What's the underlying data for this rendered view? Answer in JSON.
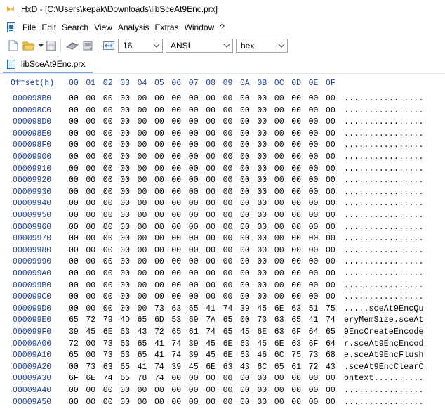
{
  "window": {
    "title": "HxD - [C:\\Users\\kepak\\Downloads\\libSceAt9Enc.prx]"
  },
  "menu": {
    "items": [
      "File",
      "Edit",
      "Search",
      "View",
      "Analysis",
      "Extras",
      "Window",
      "?"
    ]
  },
  "toolbar": {
    "bytes_per_row": "16",
    "charset": "ANSI",
    "display_mode": "hex"
  },
  "tab": {
    "label": "libSceAt9Enc.prx"
  },
  "hex": {
    "offset_header": "Offset(h)",
    "column_headers": [
      "00",
      "01",
      "02",
      "03",
      "04",
      "05",
      "06",
      "07",
      "08",
      "09",
      "0A",
      "0B",
      "0C",
      "0D",
      "0E",
      "0F"
    ],
    "rows": [
      {
        "offset": "000098B0",
        "bytes": [
          "00",
          "00",
          "00",
          "00",
          "00",
          "00",
          "00",
          "00",
          "00",
          "00",
          "00",
          "00",
          "00",
          "00",
          "00",
          "00"
        ],
        "ascii": "................"
      },
      {
        "offset": "000098C0",
        "bytes": [
          "00",
          "00",
          "00",
          "00",
          "00",
          "00",
          "00",
          "00",
          "00",
          "00",
          "00",
          "00",
          "00",
          "00",
          "00",
          "00"
        ],
        "ascii": "................"
      },
      {
        "offset": "000098D0",
        "bytes": [
          "00",
          "00",
          "00",
          "00",
          "00",
          "00",
          "00",
          "00",
          "00",
          "00",
          "00",
          "00",
          "00",
          "00",
          "00",
          "00"
        ],
        "ascii": "................"
      },
      {
        "offset": "000098E0",
        "bytes": [
          "00",
          "00",
          "00",
          "00",
          "00",
          "00",
          "00",
          "00",
          "00",
          "00",
          "00",
          "00",
          "00",
          "00",
          "00",
          "00"
        ],
        "ascii": "................"
      },
      {
        "offset": "000098F0",
        "bytes": [
          "00",
          "00",
          "00",
          "00",
          "00",
          "00",
          "00",
          "00",
          "00",
          "00",
          "00",
          "00",
          "00",
          "00",
          "00",
          "00"
        ],
        "ascii": "................"
      },
      {
        "offset": "00009900",
        "bytes": [
          "00",
          "00",
          "00",
          "00",
          "00",
          "00",
          "00",
          "00",
          "00",
          "00",
          "00",
          "00",
          "00",
          "00",
          "00",
          "00"
        ],
        "ascii": "................"
      },
      {
        "offset": "00009910",
        "bytes": [
          "00",
          "00",
          "00",
          "00",
          "00",
          "00",
          "00",
          "00",
          "00",
          "00",
          "00",
          "00",
          "00",
          "00",
          "00",
          "00"
        ],
        "ascii": "................"
      },
      {
        "offset": "00009920",
        "bytes": [
          "00",
          "00",
          "00",
          "00",
          "00",
          "00",
          "00",
          "00",
          "00",
          "00",
          "00",
          "00",
          "00",
          "00",
          "00",
          "00"
        ],
        "ascii": "................"
      },
      {
        "offset": "00009930",
        "bytes": [
          "00",
          "00",
          "00",
          "00",
          "00",
          "00",
          "00",
          "00",
          "00",
          "00",
          "00",
          "00",
          "00",
          "00",
          "00",
          "00"
        ],
        "ascii": "................"
      },
      {
        "offset": "00009940",
        "bytes": [
          "00",
          "00",
          "00",
          "00",
          "00",
          "00",
          "00",
          "00",
          "00",
          "00",
          "00",
          "00",
          "00",
          "00",
          "00",
          "00"
        ],
        "ascii": "................"
      },
      {
        "offset": "00009950",
        "bytes": [
          "00",
          "00",
          "00",
          "00",
          "00",
          "00",
          "00",
          "00",
          "00",
          "00",
          "00",
          "00",
          "00",
          "00",
          "00",
          "00"
        ],
        "ascii": "................"
      },
      {
        "offset": "00009960",
        "bytes": [
          "00",
          "00",
          "00",
          "00",
          "00",
          "00",
          "00",
          "00",
          "00",
          "00",
          "00",
          "00",
          "00",
          "00",
          "00",
          "00"
        ],
        "ascii": "................"
      },
      {
        "offset": "00009970",
        "bytes": [
          "00",
          "00",
          "00",
          "00",
          "00",
          "00",
          "00",
          "00",
          "00",
          "00",
          "00",
          "00",
          "00",
          "00",
          "00",
          "00"
        ],
        "ascii": "................"
      },
      {
        "offset": "00009980",
        "bytes": [
          "00",
          "00",
          "00",
          "00",
          "00",
          "00",
          "00",
          "00",
          "00",
          "00",
          "00",
          "00",
          "00",
          "00",
          "00",
          "00"
        ],
        "ascii": "................"
      },
      {
        "offset": "00009990",
        "bytes": [
          "00",
          "00",
          "00",
          "00",
          "00",
          "00",
          "00",
          "00",
          "00",
          "00",
          "00",
          "00",
          "00",
          "00",
          "00",
          "00"
        ],
        "ascii": "................"
      },
      {
        "offset": "000099A0",
        "bytes": [
          "00",
          "00",
          "00",
          "00",
          "00",
          "00",
          "00",
          "00",
          "00",
          "00",
          "00",
          "00",
          "00",
          "00",
          "00",
          "00"
        ],
        "ascii": "................"
      },
      {
        "offset": "000099B0",
        "bytes": [
          "00",
          "00",
          "00",
          "00",
          "00",
          "00",
          "00",
          "00",
          "00",
          "00",
          "00",
          "00",
          "00",
          "00",
          "00",
          "00"
        ],
        "ascii": "................"
      },
      {
        "offset": "000099C0",
        "bytes": [
          "00",
          "00",
          "00",
          "00",
          "00",
          "00",
          "00",
          "00",
          "00",
          "00",
          "00",
          "00",
          "00",
          "00",
          "00",
          "00"
        ],
        "ascii": "................"
      },
      {
        "offset": "000099D0",
        "bytes": [
          "00",
          "00",
          "00",
          "00",
          "00",
          "73",
          "63",
          "65",
          "41",
          "74",
          "39",
          "45",
          "6E",
          "63",
          "51",
          "75"
        ],
        "ascii": ".....sceAt9EncQu"
      },
      {
        "offset": "000099E0",
        "bytes": [
          "65",
          "72",
          "79",
          "4D",
          "65",
          "6D",
          "53",
          "69",
          "7A",
          "65",
          "00",
          "73",
          "63",
          "65",
          "41",
          "74"
        ],
        "ascii": "eryMemSize.sceAt"
      },
      {
        "offset": "000099F0",
        "bytes": [
          "39",
          "45",
          "6E",
          "63",
          "43",
          "72",
          "65",
          "61",
          "74",
          "65",
          "45",
          "6E",
          "63",
          "6F",
          "64",
          "65"
        ],
        "ascii": "9EncCreateEncode"
      },
      {
        "offset": "00009A00",
        "bytes": [
          "72",
          "00",
          "73",
          "63",
          "65",
          "41",
          "74",
          "39",
          "45",
          "6E",
          "63",
          "45",
          "6E",
          "63",
          "6F",
          "64"
        ],
        "ascii": "r.sceAt9EncEncod"
      },
      {
        "offset": "00009A10",
        "bytes": [
          "65",
          "00",
          "73",
          "63",
          "65",
          "41",
          "74",
          "39",
          "45",
          "6E",
          "63",
          "46",
          "6C",
          "75",
          "73",
          "68"
        ],
        "ascii": "e.sceAt9EncFlush"
      },
      {
        "offset": "00009A20",
        "bytes": [
          "00",
          "73",
          "63",
          "65",
          "41",
          "74",
          "39",
          "45",
          "6E",
          "63",
          "43",
          "6C",
          "65",
          "61",
          "72",
          "43"
        ],
        "ascii": ".sceAt9EncClearC"
      },
      {
        "offset": "00009A30",
        "bytes": [
          "6F",
          "6E",
          "74",
          "65",
          "78",
          "74",
          "00",
          "00",
          "00",
          "00",
          "00",
          "00",
          "00",
          "00",
          "00",
          "00"
        ],
        "ascii": "ontext.........."
      },
      {
        "offset": "00009A40",
        "bytes": [
          "00",
          "00",
          "00",
          "00",
          "00",
          "00",
          "00",
          "00",
          "00",
          "00",
          "00",
          "00",
          "00",
          "00",
          "00",
          "00"
        ],
        "ascii": "................"
      },
      {
        "offset": "00009A50",
        "bytes": [
          "00",
          "00",
          "00",
          "00",
          "00",
          "00",
          "00",
          "00",
          "00",
          "00",
          "00",
          "00",
          "00",
          "00",
          "00",
          "00"
        ],
        "ascii": "................"
      }
    ]
  },
  "colors": {
    "offset_blue": "#1b3f9c",
    "tab_underline": "#7aa7d8"
  },
  "icons": [
    "hxd-app-icon",
    "new-file-icon",
    "open-folder-icon",
    "save-icon",
    "ram-icon",
    "disk-icon",
    "bytes-per-row-icon",
    "chevron-down-icon"
  ]
}
